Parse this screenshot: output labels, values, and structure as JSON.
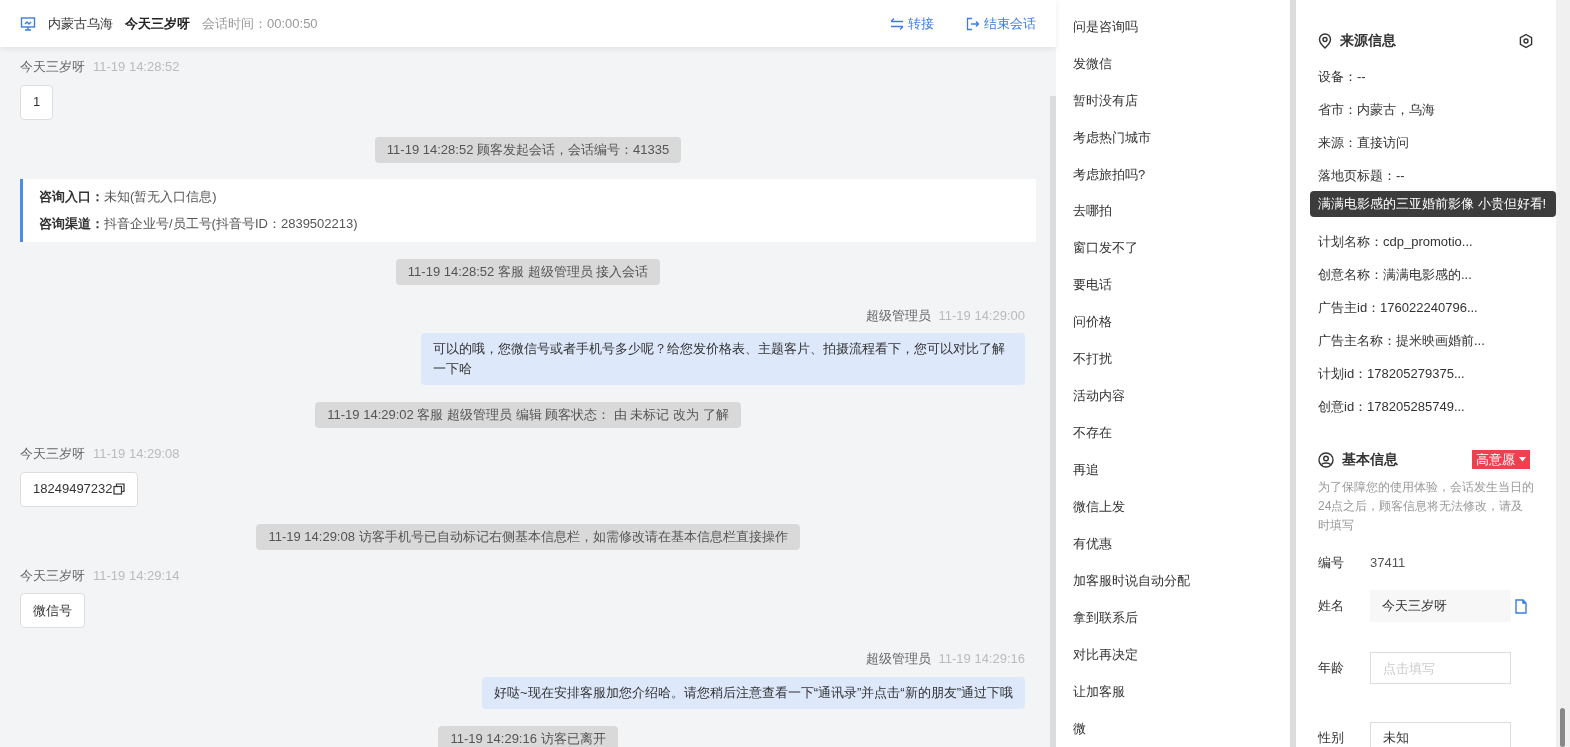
{
  "header": {
    "location": "内蒙古乌海",
    "customer": "今天三岁呀",
    "duration_label": "会话时间：",
    "duration": "00:00:50",
    "actions": [
      {
        "kind": "transfer",
        "label": "转接"
      },
      {
        "kind": "end",
        "label": "结束会话"
      }
    ]
  },
  "messages": [
    {
      "kind": "customer",
      "name": "今天三岁呀",
      "time": "11-19 14:28:52",
      "text": "1",
      "copyable": false
    },
    {
      "kind": "system",
      "text": "11-19 14:28:52 顾客发起会话，会话编号：41335"
    },
    {
      "kind": "info",
      "rows": [
        {
          "label": "咨询入口：",
          "value": "未知(暂无入口信息)"
        },
        {
          "label": "咨询渠道：",
          "value": "抖音企业号/员工号(抖音号ID：2839502213)"
        }
      ]
    },
    {
      "kind": "system",
      "text": "11-19 14:28:52 客服 超级管理员 接入会话"
    },
    {
      "kind": "agent",
      "name": "超级管理员",
      "time": "11-19 14:29:00",
      "text": "可以的哦，您微信号或者手机号多少呢？给您发价格表、主题客片、拍摄流程看下，您可以对比了解一下哈"
    },
    {
      "kind": "system",
      "text": "11-19 14:29:02 客服 超级管理员 编辑 顾客状态： 由 未标记 改为 了解"
    },
    {
      "kind": "customer",
      "name": "今天三岁呀",
      "time": "11-19 14:29:08",
      "text": "18249497232",
      "copyable": true
    },
    {
      "kind": "system",
      "text": "11-19 14:29:08 访客手机号已自动标记右侧基本信息栏，如需修改请在基本信息栏直接操作"
    },
    {
      "kind": "customer",
      "name": "今天三岁呀",
      "time": "11-19 14:29:14",
      "text": "微信号",
      "copyable": false
    },
    {
      "kind": "agent",
      "name": "超级管理员",
      "time": "11-19 14:29:16",
      "text": "好哒~现在安排客服加您介绍哈。请您稍后注意查看一下“通讯录”并点击“新的朋友”通过下哦"
    },
    {
      "kind": "system",
      "text": "11-19 14:29:16 访客已离开"
    }
  ],
  "quick_replies": [
    "问是咨询吗",
    "发微信",
    "暂时没有店",
    "考虑热门城市",
    "考虑旅拍吗?",
    "去哪拍",
    "窗口发不了",
    "要电话",
    "问价格",
    "不打扰",
    "活动内容",
    "不存在",
    "再追",
    "微信上发",
    "有优惠",
    "加客服时说自动分配",
    "拿到联系后",
    "对比再决定",
    "让加客服",
    "微"
  ],
  "source_info": {
    "title": "来源信息",
    "rows": [
      "设备：--",
      "省市：内蒙古，乌海",
      "来源：直接访问",
      "落地页标题：--"
    ],
    "tooltip": "满满电影感的三亚婚前影像 小贵但好看!",
    "rows_after": [
      "计划名称：cdp_promotio...",
      "创意名称：满满电影感的...",
      "广告主id：176022240796...",
      "广告主名称：提米映画婚前...",
      "计划id：178205279375...",
      "创意id：178205285749..."
    ]
  },
  "basic_info": {
    "title": "基本信息",
    "intent": "高意愿",
    "notice": "为了保障您的使用体验，会话发生当日的24点之后，顾客信息将无法修改，请及时填写",
    "fields": [
      {
        "kind": "text",
        "label": "编号",
        "value": "37411"
      },
      {
        "kind": "filled",
        "label": "姓名",
        "value": "今天三岁呀"
      },
      {
        "kind": "input",
        "label": "年龄",
        "placeholder": "点击填写"
      },
      {
        "kind": "input",
        "label": "性别",
        "value": "未知"
      }
    ]
  }
}
